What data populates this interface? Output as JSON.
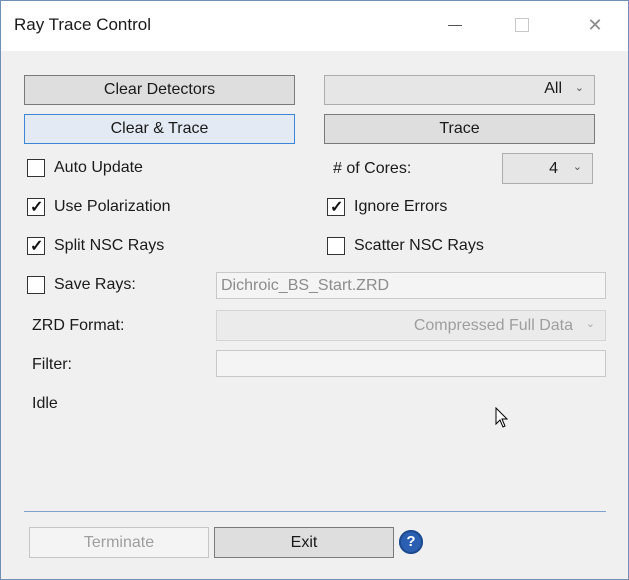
{
  "window": {
    "title": "Ray Trace Control"
  },
  "buttons": {
    "clear_detectors": "Clear Detectors",
    "clear_and_trace": "Clear & Trace",
    "trace": "Trace",
    "terminate": "Terminate",
    "exit": "Exit"
  },
  "detector_select": {
    "value": "All"
  },
  "options": {
    "auto_update": {
      "label": "Auto Update",
      "checked": false
    },
    "use_polarization": {
      "label": "Use Polarization",
      "checked": true
    },
    "split_nsc_rays": {
      "label": "Split NSC Rays",
      "checked": true
    },
    "ignore_errors": {
      "label": "Ignore Errors",
      "checked": true
    },
    "scatter_nsc_rays": {
      "label": "Scatter NSC Rays",
      "checked": false
    },
    "save_rays": {
      "label": "Save Rays:",
      "checked": false
    }
  },
  "cores": {
    "label": "# of Cores:",
    "value": "4"
  },
  "save_rays_file": {
    "value": "Dichroic_BS_Start.ZRD"
  },
  "zrd_format": {
    "label": "ZRD Format:",
    "value": "Compressed Full Data"
  },
  "filter": {
    "label": "Filter:",
    "value": ""
  },
  "status": {
    "text": "Idle"
  },
  "help": {
    "glyph": "?"
  }
}
